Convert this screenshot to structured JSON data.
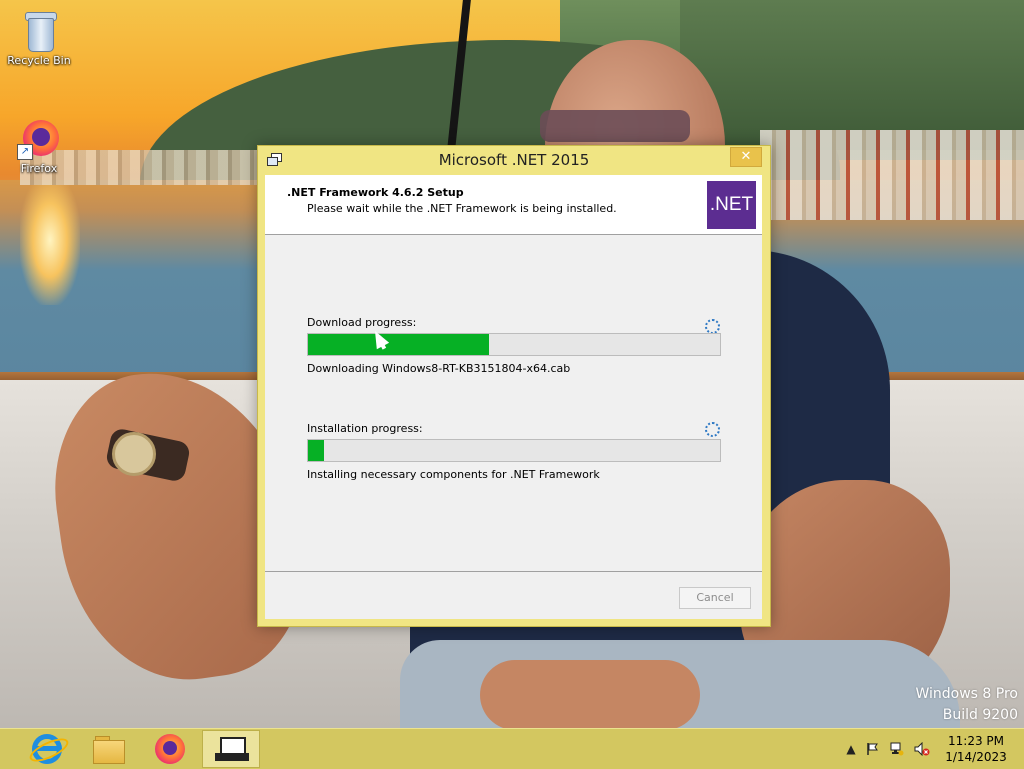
{
  "desktop": {
    "icons": [
      {
        "label": "Recycle Bin",
        "icon": "recycle-bin-icon"
      },
      {
        "label": "Firefox",
        "icon": "firefox-icon"
      }
    ],
    "watermark": {
      "line1": "Windows 8 Pro",
      "line2": "Build 9200"
    }
  },
  "window": {
    "title": "Microsoft .NET 2015",
    "close_label": "✕",
    "header": {
      "title": ".NET Framework 4.6.2 Setup",
      "subtitle": "Please wait while the .NET Framework is being installed.",
      "logo_text": ".NET"
    },
    "download": {
      "label": "Download progress:",
      "progress": 0.44,
      "status": "Downloading Windows8-RT-KB3151804-x64.cab"
    },
    "install": {
      "label": "Installation progress:",
      "progress": 0.04,
      "status": "Installing necessary components for .NET Framework"
    },
    "cancel_label": "Cancel"
  },
  "taskbar": {
    "apps": [
      "internet-explorer-icon",
      "file-explorer-icon",
      "firefox-icon",
      "setup-window-icon"
    ],
    "clock": {
      "time": "11:23 PM",
      "date": "1/14/2023"
    },
    "tray_up": "▲"
  },
  "colors": {
    "accent": "#d3c760",
    "progress_fill": "#06b025",
    "net_purple": "#5c2d91"
  }
}
